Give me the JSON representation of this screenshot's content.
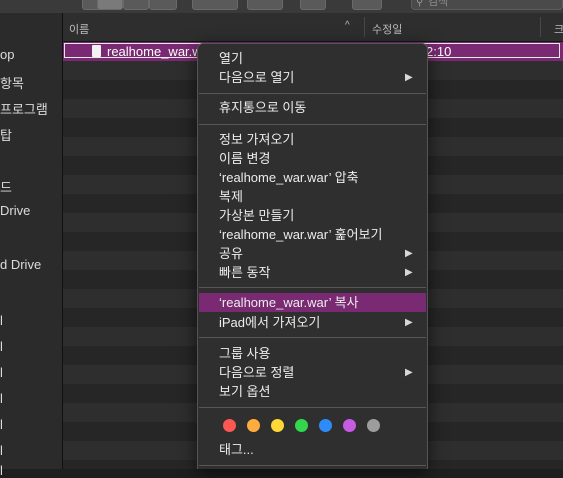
{
  "sidebar": {
    "items": [
      "op",
      "항목",
      "프로그램",
      "탑",
      "드",
      "Drive",
      "d Drive",
      "l",
      "l",
      "l",
      "l",
      "l",
      "l",
      "l"
    ]
  },
  "header": {
    "name_col": "이름",
    "date_col": "수정일",
    "extra_col": "크",
    "sort_arrow": "^"
  },
  "search": {
    "placeholder": "검색",
    "icon": "magnifier-icon"
  },
  "file": {
    "name": "realhome_war.war",
    "date_fragment": "2:10"
  },
  "menu": {
    "open": "열기",
    "open_with": "다음으로 열기",
    "trash": "휴지통으로 이동",
    "get_info": "정보 가져오기",
    "rename": "이름 변경",
    "compress": "‘realhome_war.war’ 압축",
    "duplicate": "복제",
    "make_alias": "가상본 만들기",
    "quick_look": "‘realhome_war.war’ 훑어보기",
    "share": "공유",
    "quick_actions": "빠른 동작",
    "copy": "‘realhome_war.war’ 복사",
    "import_ipad": "iPad에서 가져오기",
    "use_groups": "그룹 사용",
    "sort_by": "다음으로 정렬",
    "view_options": "보기 옵션",
    "tags": "태그...",
    "submenu_arrow": "▶"
  },
  "tag_colors": [
    "#fc5753",
    "#fdac3d",
    "#fdd836",
    "#34d64d",
    "#2f8bf7",
    "#c65be4",
    "#9d9d9d"
  ],
  "colors": {
    "selection": "#7a2a72",
    "menu_bg": "#2f2f2f",
    "window_bg": "#1f1f1f"
  }
}
